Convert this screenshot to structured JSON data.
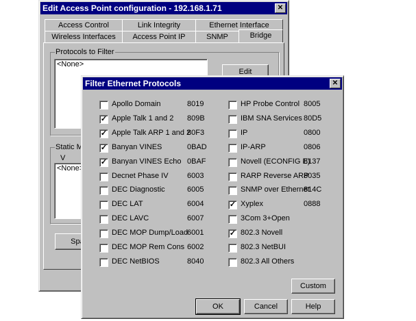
{
  "main_dialog": {
    "title": "Edit Access Point configuration - 192.168.1.71",
    "close_glyph": "✕",
    "tabs_back": [
      "Access Control",
      "Link Integrity",
      "Ethernet Interface"
    ],
    "tabs_front": [
      "Wireless Interfaces",
      "Access Point IP",
      "SNMP",
      "Bridge"
    ],
    "active_tab": "Bridge",
    "protocols_group_label": "Protocols to Filter",
    "protocols_list_value": "<None>",
    "edit_button": "Edit",
    "static_group_label": "Static MA",
    "static_col_header": "V",
    "static_list_value": "<None>",
    "span_button": "Span"
  },
  "filter_dialog": {
    "title": "Filter Ethernet Protocols",
    "close_glyph": "✕",
    "left_column": [
      {
        "label": "Apollo Domain",
        "code": "8019",
        "checked": false
      },
      {
        "label": "Apple Talk 1 and 2",
        "code": "809B",
        "checked": true
      },
      {
        "label": "Apple Talk ARP 1 and 2",
        "code": "80F3",
        "checked": true
      },
      {
        "label": "Banyan VINES",
        "code": "0BAD",
        "checked": true
      },
      {
        "label": "Banyan VINES Echo",
        "code": "0BAF",
        "checked": true
      },
      {
        "label": "Decnet Phase IV",
        "code": "6003",
        "checked": false
      },
      {
        "label": "DEC Diagnostic",
        "code": "6005",
        "checked": false
      },
      {
        "label": "DEC LAT",
        "code": "6004",
        "checked": false
      },
      {
        "label": "DEC LAVC",
        "code": "6007",
        "checked": false
      },
      {
        "label": "DEC MOP Dump/Load",
        "code": "6001",
        "checked": false
      },
      {
        "label": "DEC MOP Rem Cons",
        "code": "6002",
        "checked": false
      },
      {
        "label": "DEC NetBIOS",
        "code": "8040",
        "checked": false
      }
    ],
    "right_column": [
      {
        "label": "HP Probe Control",
        "code": "8005",
        "checked": false
      },
      {
        "label": "IBM SNA Services",
        "code": "80D5",
        "checked": false
      },
      {
        "label": "IP",
        "code": "0800",
        "checked": false
      },
      {
        "label": "IP-ARP",
        "code": "0806",
        "checked": false
      },
      {
        "label": "Novell (ECONFIG E)",
        "code": "8137",
        "checked": false
      },
      {
        "label": "RARP Reverse ARP",
        "code": "8035",
        "checked": false
      },
      {
        "label": "SNMP over Ethernet",
        "code": "814C",
        "checked": false
      },
      {
        "label": "Xyplex",
        "code": "0888",
        "checked": true
      },
      {
        "label": "3Com 3+Open",
        "code": "",
        "checked": false
      },
      {
        "label": "802.3 Novell",
        "code": "",
        "checked": true
      },
      {
        "label": "802.3 NetBUI",
        "code": "",
        "checked": false
      },
      {
        "label": "802.3 All Others",
        "code": "",
        "checked": false
      }
    ],
    "custom_button": "Custom",
    "ok_button": "OK",
    "cancel_button": "Cancel",
    "help_button": "Help"
  },
  "colors": {
    "title_bar": "#000080",
    "face": "#c0c0c0"
  }
}
